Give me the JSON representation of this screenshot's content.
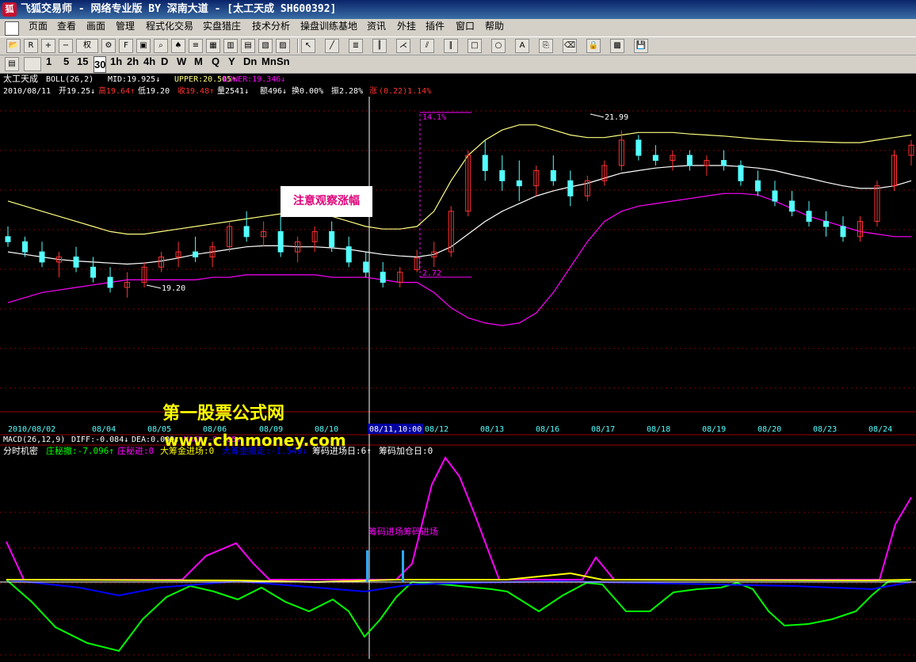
{
  "window": {
    "title": "飞狐交易师 - 网络专业版 BY 深南大道 - [太工天成 SH600392]",
    "logo_icon": "fox-logo-icon"
  },
  "menu": [
    "页面",
    "查看",
    "画面",
    "管理",
    "程式化交易",
    "实盘猎庄",
    "技术分析",
    "操盘训练基地",
    "资讯",
    "外挂",
    "插件",
    "窗口",
    "帮助"
  ],
  "toolbar": {
    "right_label": "权",
    "icons": [
      "open-icon",
      "rsi-icon",
      "add-icon",
      "minus-icon",
      "weight-dropdown",
      "tools-icon",
      "f10-icon",
      "book-icon",
      "search-icon",
      "alarm-icon",
      "news-icon",
      "window1-icon",
      "window2-icon",
      "window3-icon",
      "window4-icon",
      "window5-icon",
      "cursor-icon",
      "line-draw-icon",
      "fibo-icon",
      "bars-icon",
      "fan-icon",
      "channel-icon",
      "parallel-icon",
      "rect-icon",
      "ellipse-icon",
      "text-icon",
      "copy-icon",
      "eraser-icon",
      "lock-icon",
      "color-icon",
      "save-icon"
    ]
  },
  "periods": [
    "1",
    "5",
    "15",
    "30",
    "1h",
    "2h",
    "4h",
    "D",
    "W",
    "M",
    "Q",
    "Y",
    "Dn",
    "Mn",
    "Sn"
  ],
  "main_panel": {
    "info_line1": {
      "stock": "太工天成",
      "indicator": "BOLL(26,2)",
      "mid": "MID:19.925↓",
      "upper": "UPPER:20.505↑",
      "lower": "LOWER:19.346↓"
    },
    "info_line2": {
      "date": "2010/08/11",
      "open": "开19.25↓",
      "high": "高19.64↑",
      "low": "低19.20",
      "close": "收19.48↑",
      "volume": "量2541↓",
      "amount": "额496↓",
      "turnover": "换0.00%",
      "amplitude": "振2.28%",
      "change_label": "涨",
      "change_value": "(0.22)1.14%"
    },
    "note": "注意观察涨幅",
    "marker_top": "14.1%",
    "marker_bottom": "2.72",
    "high_label": "21.99",
    "low_label": "19.20",
    "watermark_cn": "第一股票公式网",
    "watermark_url": "www.chnmoney.com"
  },
  "x_axis": {
    "labels": [
      "2010/08/02",
      "08/04",
      "08/05",
      "08/06",
      "08/09",
      "08/10",
      "08/11,10:00",
      "08/12",
      "08/13",
      "08/16",
      "08/17",
      "08/18",
      "08/19",
      "08/20",
      "08/23",
      "08/24"
    ]
  },
  "macd_line": {
    "text": "MACD(26,12,9)",
    "diff": "DIFF:-0.084↓",
    "dea": "DEA:0.009↓",
    "macd": "MACD:-0.185↑"
  },
  "sub_panel": {
    "name": "分时机密",
    "items": [
      {
        "label": "庄秘撤:-7.096↑",
        "color": "#00ff00"
      },
      {
        "label": "庄秘进:0",
        "color": "#ff00ff"
      },
      {
        "label": "大筹金进场:0",
        "color": "#ffff00"
      },
      {
        "label": "大筹金撤走:-1.549↓",
        "color": "#0000ff"
      },
      {
        "label": "筹码进场日:6↑",
        "color": "#ffffff"
      },
      {
        "label": "筹码加仓日:0",
        "color": "#ffffff"
      }
    ],
    "signal_label": "筹码进场筹码进场"
  },
  "colors": {
    "up": "#ff3232",
    "down": "#54ffff",
    "boll_mid": "#ffffff",
    "boll_upper": "#ffff80",
    "boll_lower": "#ff00ff",
    "grid": "#800000"
  },
  "chart_data": {
    "type": "candlestick",
    "x": [
      "2010/08/02",
      "08/04",
      "08/05",
      "08/06",
      "08/09",
      "08/10",
      "08/11",
      "08/12",
      "08/13",
      "08/16",
      "08/17",
      "08/18",
      "08/19",
      "08/20",
      "08/23",
      "08/24"
    ],
    "ylim": [
      16.5,
      22.5
    ],
    "candles": [
      [
        19.9,
        20.1,
        19.7,
        19.8
      ],
      [
        19.8,
        19.9,
        19.5,
        19.6
      ],
      [
        19.6,
        19.8,
        19.3,
        19.4
      ],
      [
        19.4,
        19.6,
        19.1,
        19.5
      ],
      [
        19.5,
        19.7,
        19.2,
        19.3
      ],
      [
        19.3,
        19.5,
        19.0,
        19.1
      ],
      [
        19.1,
        19.3,
        18.8,
        18.9
      ],
      [
        18.9,
        19.2,
        18.7,
        19.0
      ],
      [
        19.0,
        19.4,
        18.9,
        19.3
      ],
      [
        19.3,
        19.6,
        19.2,
        19.5
      ],
      [
        19.5,
        19.8,
        19.3,
        19.6
      ],
      [
        19.6,
        19.9,
        19.4,
        19.5
      ],
      [
        19.5,
        19.8,
        19.3,
        19.7
      ],
      [
        19.7,
        20.2,
        19.6,
        20.1
      ],
      [
        20.1,
        20.4,
        19.8,
        19.9
      ],
      [
        19.9,
        20.2,
        19.7,
        20.0
      ],
      [
        20.0,
        20.3,
        19.5,
        19.6
      ],
      [
        19.6,
        19.9,
        19.4,
        19.8
      ],
      [
        19.8,
        20.1,
        19.6,
        20.0
      ],
      [
        20.0,
        20.2,
        19.6,
        19.7
      ],
      [
        19.7,
        19.9,
        19.3,
        19.4
      ],
      [
        19.4,
        19.6,
        19.1,
        19.2
      ],
      [
        19.2,
        19.4,
        18.9,
        19.0
      ],
      [
        19.0,
        19.3,
        18.9,
        19.2
      ],
      [
        19.25,
        19.64,
        19.2,
        19.48
      ],
      [
        19.5,
        19.8,
        19.3,
        19.6
      ],
      [
        19.6,
        20.5,
        19.5,
        20.4
      ],
      [
        20.4,
        21.6,
        20.3,
        21.5
      ],
      [
        21.5,
        21.8,
        21.0,
        21.2
      ],
      [
        21.2,
        21.5,
        20.8,
        21.0
      ],
      [
        21.0,
        21.4,
        20.6,
        20.9
      ],
      [
        20.9,
        21.3,
        20.7,
        21.2
      ],
      [
        21.2,
        21.5,
        20.9,
        21.0
      ],
      [
        21.0,
        21.2,
        20.5,
        20.7
      ],
      [
        20.7,
        21.1,
        20.6,
        21.0
      ],
      [
        21.0,
        21.4,
        20.9,
        21.3
      ],
      [
        21.3,
        21.99,
        21.2,
        21.8
      ],
      [
        21.8,
        21.9,
        21.4,
        21.5
      ],
      [
        21.5,
        21.7,
        21.3,
        21.4
      ],
      [
        21.4,
        21.6,
        21.2,
        21.5
      ],
      [
        21.5,
        21.6,
        21.2,
        21.3
      ],
      [
        21.3,
        21.5,
        21.1,
        21.4
      ],
      [
        21.4,
        21.6,
        21.2,
        21.3
      ],
      [
        21.3,
        21.4,
        20.9,
        21.0
      ],
      [
        21.0,
        21.2,
        20.7,
        20.8
      ],
      [
        20.8,
        21.0,
        20.5,
        20.6
      ],
      [
        20.6,
        20.8,
        20.3,
        20.4
      ],
      [
        20.4,
        20.6,
        20.1,
        20.2
      ],
      [
        20.2,
        20.4,
        19.9,
        20.1
      ],
      [
        20.1,
        20.3,
        19.8,
        19.9
      ],
      [
        19.9,
        20.3,
        19.8,
        20.2
      ],
      [
        20.2,
        21.0,
        20.1,
        20.9
      ],
      [
        20.9,
        21.6,
        20.8,
        21.5
      ],
      [
        21.5,
        21.8,
        21.3,
        21.7
      ]
    ],
    "series": [
      {
        "name": "MID",
        "values": [
          19.6,
          19.55,
          19.5,
          19.45,
          19.42,
          19.4,
          19.38,
          19.36,
          19.38,
          19.42,
          19.48,
          19.55,
          19.6,
          19.65,
          19.7,
          19.72,
          19.72,
          19.7,
          19.7,
          19.68,
          19.65,
          19.6,
          19.55,
          19.52,
          19.5,
          19.55,
          19.7,
          19.95,
          20.2,
          20.4,
          20.55,
          20.7,
          20.8,
          20.88,
          20.95,
          21.05,
          21.15,
          21.2,
          21.25,
          21.28,
          21.3,
          21.3,
          21.3,
          21.28,
          21.25,
          21.2,
          21.12,
          21.05,
          20.97,
          20.9,
          20.85,
          20.85,
          20.9,
          21.0
        ]
      },
      {
        "name": "UPPER",
        "values": [
          20.6,
          20.5,
          20.4,
          20.3,
          20.2,
          20.1,
          20.0,
          19.95,
          19.95,
          20.0,
          20.05,
          20.1,
          20.15,
          20.2,
          20.25,
          20.3,
          20.35,
          20.35,
          20.3,
          20.3,
          20.2,
          20.1,
          20.05,
          20.05,
          20.1,
          20.4,
          21.0,
          21.5,
          21.8,
          22.0,
          22.1,
          22.1,
          22.0,
          21.9,
          21.85,
          21.85,
          21.9,
          21.95,
          21.95,
          21.95,
          21.92,
          21.9,
          21.88,
          21.85,
          21.82,
          21.8,
          21.78,
          21.77,
          21.76,
          21.75,
          21.75,
          21.8,
          21.85,
          21.9
        ]
      },
      {
        "name": "LOWER",
        "values": [
          18.6,
          18.7,
          18.8,
          18.85,
          18.9,
          18.95,
          19.0,
          19.05,
          19.05,
          19.05,
          19.05,
          19.05,
          19.1,
          19.1,
          19.15,
          19.15,
          19.15,
          19.15,
          19.15,
          19.1,
          19.1,
          19.1,
          19.05,
          19.0,
          19.0,
          18.8,
          18.5,
          18.3,
          18.2,
          18.15,
          18.2,
          18.4,
          18.8,
          19.3,
          19.8,
          20.2,
          20.4,
          20.5,
          20.55,
          20.6,
          20.65,
          20.7,
          20.75,
          20.75,
          20.72,
          20.6,
          20.45,
          20.3,
          20.2,
          20.1,
          20.0,
          19.95,
          19.9,
          19.9
        ]
      }
    ]
  }
}
